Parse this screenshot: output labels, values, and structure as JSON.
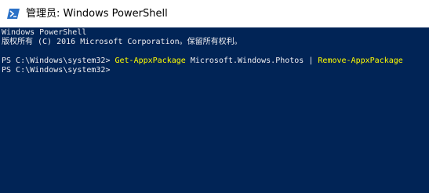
{
  "window": {
    "title": "管理员: Windows PowerShell",
    "icon": "powershell-icon"
  },
  "console": {
    "banner_line1": "Windows PowerShell",
    "banner_line2": "版权所有 (C) 2016 Microsoft Corporation。保留所有权利。",
    "entries": [
      {
        "prompt": "PS C:\\Windows\\system32> ",
        "cmdlet1": "Get-AppxPackage",
        "argument": " Microsoft.Windows.Photos ",
        "pipe": "| ",
        "cmdlet2": "Remove-AppxPackage"
      },
      {
        "prompt": "PS C:\\Windows\\system32>"
      }
    ],
    "colors": {
      "background": "#012456",
      "text": "#eeedf0",
      "cmdlet": "#ffff00"
    }
  }
}
